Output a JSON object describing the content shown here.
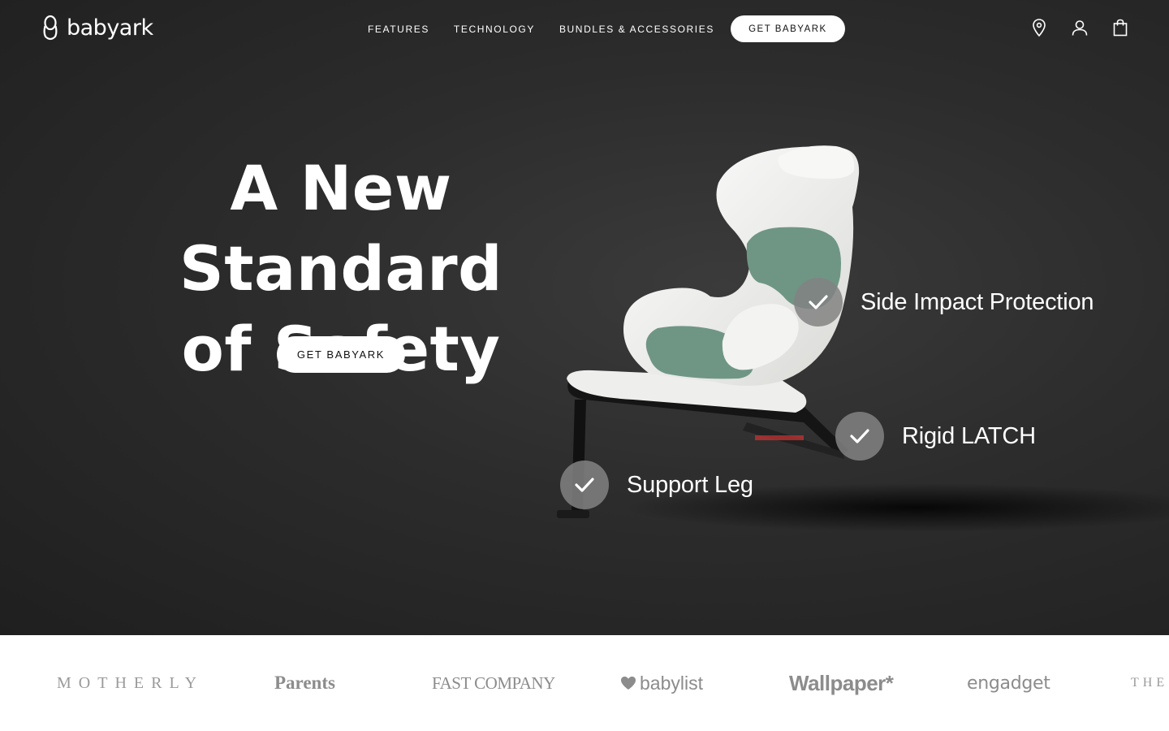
{
  "brand": {
    "name": "babyark"
  },
  "nav": {
    "links": [
      "FEATURES",
      "TECHNOLOGY",
      "BUNDLES & ACCESSORIES"
    ],
    "cta": "GET BABYARK"
  },
  "tools": [
    {
      "icon": "location-pin-icon"
    },
    {
      "icon": "account-icon"
    },
    {
      "icon": "shopping-bag-icon"
    }
  ],
  "hero": {
    "headline_line1": "A New Standard",
    "headline_line2": "of Safety",
    "cta": "GET BABYARK",
    "callouts": [
      "Side Impact Protection",
      "Rigid LATCH",
      "Support Leg"
    ]
  },
  "colors": {
    "hero_bg": "#2c2c2c",
    "seat_shell": "#f1f1ef",
    "seat_accent": "#6f9685",
    "check_bg": "#828282",
    "press_bg": "#ffffff"
  },
  "press": {
    "logos": [
      "MOTHERLY",
      "Parents",
      "FAST COMPANY",
      "babylist",
      "Wallpaper*",
      "engadget",
      "THE"
    ]
  }
}
